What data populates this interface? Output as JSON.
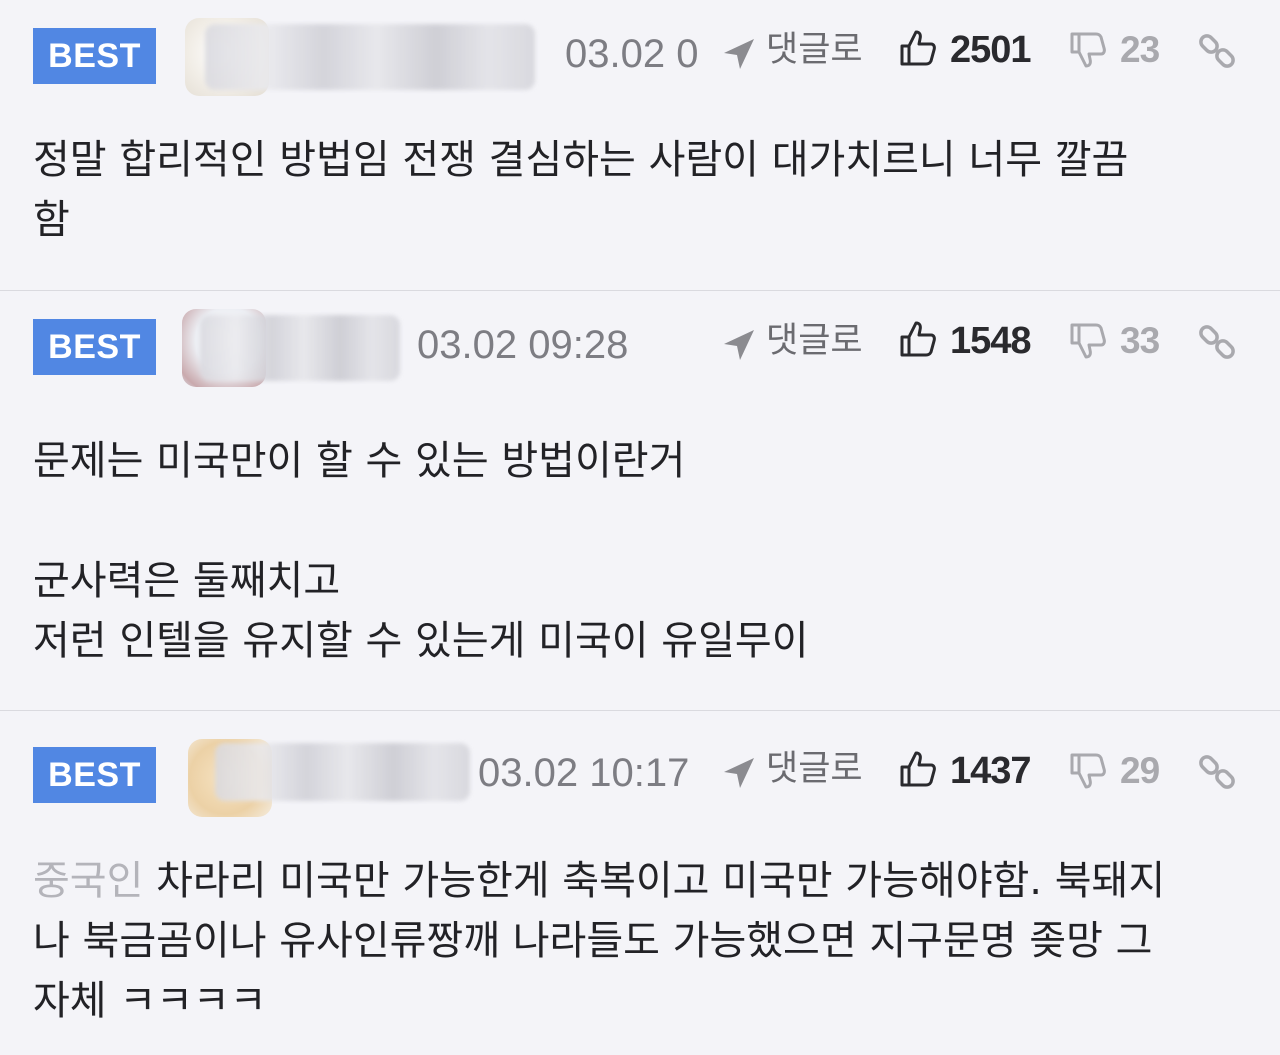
{
  "comments": [
    {
      "badge": "BEST",
      "timestamp": "03.02 0",
      "reply_label": "댓글로",
      "likes": "2501",
      "dislikes": "23",
      "body_lines": [
        "정말 합리적인 방법임 전쟁 결심하는 사람이 대가치르니 너무 깔끔",
        "함"
      ]
    },
    {
      "badge": "BEST",
      "timestamp": "03.02 09:28",
      "reply_label": "댓글로",
      "likes": "1548",
      "dislikes": "33",
      "body_lines": [
        "문제는 미국만이 할 수 있는 방법이란거",
        "군사력은 둘째치고",
        "저런 인텔을 유지할 수 있는게 미국이 유일무이"
      ]
    },
    {
      "badge": "BEST",
      "timestamp": "03.02 10:17",
      "reply_label": "댓글로",
      "likes": "1437",
      "dislikes": "29",
      "body_prefix": "중국인",
      "body_lines": [
        " 차라리 미국만 가능한게 축복이고 미국만 가능해야함. 북돼지",
        "나 북금곰이나 유사인류짱깨 나라들도 가능했으면 지구문명 좆망 그",
        "자체 ㅋㅋㅋㅋ"
      ]
    }
  ],
  "icons": {
    "reply": "reply-arrow-icon",
    "like": "thumbs-up-icon",
    "dislike": "thumbs-down-icon",
    "link": "link-icon"
  },
  "colors": {
    "badge": "#5187e3",
    "background": "#f4f4f8",
    "divider": "#dadadf"
  }
}
